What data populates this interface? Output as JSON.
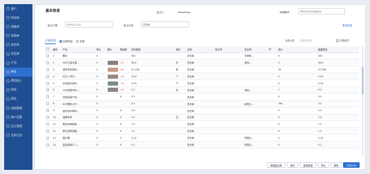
{
  "sidebar": {
    "items": [
      {
        "label": "客户",
        "icon": "user-icon"
      },
      {
        "label": "供应商",
        "icon": "truck-icon"
      },
      {
        "label": "销售单",
        "icon": "cart-icon"
      },
      {
        "label": "采购单",
        "icon": "bag-icon"
      },
      {
        "label": "收货单",
        "icon": "inbox-icon"
      },
      {
        "label": "发货单",
        "icon": "send-icon"
      },
      {
        "label": "产品",
        "icon": "box-icon"
      },
      {
        "label": "库存",
        "icon": "stack-icon",
        "active": true
      },
      {
        "label": "费用收入",
        "icon": "money-icon"
      },
      {
        "label": "财务",
        "icon": "chart-icon"
      },
      {
        "label": "报告",
        "icon": "report-icon"
      },
      {
        "label": "流程管理",
        "icon": "flow-icon"
      },
      {
        "label": "账户设置",
        "icon": "gear-icon"
      },
      {
        "label": "员工管理",
        "icon": "people-icon"
      },
      {
        "label": "业务日志",
        "icon": "log-icon"
      }
    ]
  },
  "header": {
    "title": "基本信息",
    "creator_label": "盘点人",
    "creator_value": "Maosfeng",
    "doc_no_label": "单据编号",
    "doc_no_value": "PD202511200001",
    "date_label": "盘点日期",
    "date_value": "2025-11-20",
    "warehouse_label": "盘点仓库",
    "warehouse_value": "总仓库",
    "extra_link": "更多信息"
  },
  "toolbar": {
    "tab_label": "订单信息",
    "radio_all": "全部商品",
    "radio_diff": "仅盘",
    "category_label": "全部分类",
    "category_placeholder": "请选择分类",
    "only_diff": "只看差异"
  },
  "table": {
    "headers": [
      "编号",
      "产品",
      "单价",
      "图片",
      "账面数",
      "实际数量",
      "单位",
      "仓库",
      "批次号",
      "供应商",
      "进价",
      "盘盈数量"
    ],
    "rows": [
      {
        "no": "1",
        "product": "螺丝",
        "price": "0",
        "img": "",
        "book": "",
        "actual": "300",
        "unit": "",
        "wh": "总仓库",
        "batch": "",
        "supplier": "东莞机…",
        "cost": "0",
        "diff": "300",
        "thumb": ""
      },
      {
        "no": "2",
        "product": "CNC五金手板…",
        "price": "0",
        "img": "thumb",
        "book": "-21",
        "actual": "38.4",
        "unit": "件",
        "wh": "总仓库",
        "batch": "",
        "supplier": "某机…",
        "cost": "2",
        "diff": "38.4",
        "thumb": "#8c7f78"
      },
      {
        "no": "3",
        "product": "浸渍漆改造系…",
        "price": "0",
        "img": "thumb",
        "book": "-65",
        "actual": "22.336",
        "unit": "条",
        "wh": "总仓库",
        "batch": "",
        "supplier": "",
        "cost": "35",
        "diff": "22.336",
        "thumb": "#c79a84"
      },
      {
        "no": "4",
        "product": "灯芯八号灯…",
        "price": "0",
        "img": "thumb",
        "book": "-15",
        "actual": "19.8",
        "unit": "个",
        "wh": "总仓库",
        "batch": "",
        "supplier": "",
        "cost": "0",
        "diff": "19.8",
        "thumb": "#9a8a83"
      },
      {
        "no": "5",
        "product": "光线蓝牙耳机…",
        "price": "0",
        "img": "thumb",
        "book": "-19",
        "actual": "12.8",
        "unit": "个",
        "wh": "总仓库",
        "batch": "",
        "supplier": "",
        "cost": "0",
        "diff": "12.8",
        "thumb": "#7b8e80"
      },
      {
        "no": "6",
        "product": "CNC精铣专件…",
        "price": "0",
        "img": "thumb",
        "book": "-41",
        "actual": "9.2",
        "unit": "件",
        "wh": "总仓库",
        "batch": "",
        "supplier": "某机…",
        "cost": "1",
        "diff": "9.2",
        "thumb": "#8e8784"
      },
      {
        "no": "7",
        "product": "扫描包装产品…",
        "price": "0",
        "img": "",
        "book": "0",
        "actual": "3.2",
        "unit": "",
        "wh": "总仓库",
        "batch": "",
        "supplier": "",
        "cost": "0",
        "diff": "3.2",
        "thumb": ""
      },
      {
        "no": "8",
        "product": "823塑胶公仔…",
        "price": "0",
        "img": "",
        "book": "",
        "actual": "3.2",
        "unit": "",
        "wh": "总仓库",
        "batch": "",
        "supplier": "影视公…",
        "cost": "765",
        "diff": "3.2",
        "thumb": ""
      },
      {
        "no": "9",
        "product": "品色油印刷机…",
        "price": "0",
        "img": "",
        "book": "0",
        "actual": "2.4",
        "unit": "",
        "wh": "总仓库",
        "batch": "",
        "supplier": "",
        "cost": "0",
        "diff": "2.4",
        "thumb": ""
      },
      {
        "no": "10",
        "product": "油桶车床",
        "price": "0",
        "img": "",
        "book": "0",
        "actual": "2.4",
        "unit": "匹",
        "wh": "总仓库",
        "batch": "",
        "supplier": "",
        "cost": "0",
        "diff": "2.4",
        "thumb": ""
      },
      {
        "no": "11",
        "product": "皇冠印刷胶板…",
        "price": "0",
        "img": "",
        "book": "0",
        "actual": "1.2",
        "unit": "",
        "wh": "总仓库",
        "batch": "",
        "supplier": "",
        "cost": "0",
        "diff": "1.2",
        "thumb": ""
      },
      {
        "no": "12",
        "product": "养生保养品套…",
        "price": "0",
        "img": "",
        "book": "0",
        "actual": "1.2",
        "unit": "",
        "wh": "总仓库",
        "batch": "",
        "supplier": "",
        "cost": "0",
        "diff": "1.2",
        "thumb": ""
      },
      {
        "no": "13",
        "product": "猫头鹰",
        "price": "0",
        "img": "",
        "book": "5",
        "actual": "0.12",
        "unit": "",
        "wh": "总仓库",
        "batch": "",
        "supplier": "阿里云…",
        "cost": "0",
        "diff": "0.12",
        "thumb": ""
      },
      {
        "no": "14",
        "product": "高品质纸巾（…",
        "price": "0",
        "img": "",
        "book": "0",
        "actual": "0.1",
        "unit": "",
        "wh": "总仓库",
        "batch": "",
        "supplier": "阿里云…",
        "cost": "0",
        "diff": "0.1",
        "thumb": ""
      }
    ]
  },
  "buttons": {
    "new_inventory": "新建盘点单",
    "save": "保存",
    "copy_new": "复制新增",
    "export": "导出",
    "delete": "删除",
    "print": "打印(F6)"
  },
  "colors": {
    "sidebar": "#1f4f92",
    "sidebar_active": "#2f6fce",
    "accent": "#2f6fce",
    "negative": "#e0443e"
  }
}
